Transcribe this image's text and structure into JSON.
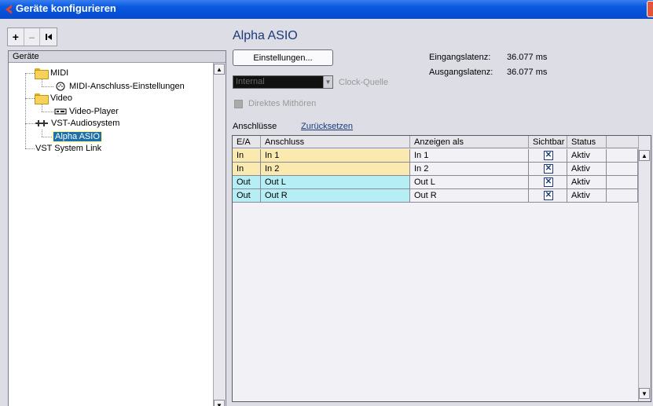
{
  "window": {
    "title": "Geräte konfigurieren"
  },
  "toolbar": {
    "add": "+",
    "remove": "–",
    "reset": "⏮"
  },
  "tree": {
    "header": "Geräte",
    "items": [
      {
        "label": "MIDI",
        "icon": "folder-icon"
      },
      {
        "label": "MIDI-Anschluss-Einstellungen",
        "icon": "midi-port-icon"
      },
      {
        "label": "Video",
        "icon": "folder-icon"
      },
      {
        "label": "Video-Player",
        "icon": "video-player-icon"
      },
      {
        "label": "VST-Audiosystem",
        "icon": "audio-system-icon"
      },
      {
        "label": "Alpha ASIO",
        "icon": "",
        "selected": true
      },
      {
        "label": "VST System Link",
        "icon": ""
      }
    ]
  },
  "main": {
    "title": "Alpha ASIO",
    "settings_button": "Einstellungen...",
    "input_latency_label": "Eingangslatenz:",
    "input_latency_value": "36.077 ms",
    "output_latency_label": "Ausgangslatenz:",
    "output_latency_value": "36.077 ms",
    "clock_source_value": "Internal",
    "clock_source_label": "Clock-Quelle",
    "direct_monitoring_label": "Direktes Mithören",
    "ports_label": "Anschlüsse",
    "reset_link": "Zurücksetzen"
  },
  "table": {
    "columns": [
      "E/A",
      "Anschluss",
      "Anzeigen als",
      "Sichtbar",
      "Status"
    ],
    "rows": [
      {
        "dir": "In",
        "port": "In 1",
        "show_as": "In 1",
        "visible": true,
        "status": "Aktiv"
      },
      {
        "dir": "In",
        "port": "In 2",
        "show_as": "In 2",
        "visible": true,
        "status": "Aktiv"
      },
      {
        "dir": "Out",
        "port": "Out L",
        "show_as": "Out L",
        "visible": true,
        "status": "Aktiv"
      },
      {
        "dir": "Out",
        "port": "Out R",
        "show_as": "Out R",
        "visible": true,
        "status": "Aktiv"
      }
    ]
  },
  "colors": {
    "input_row": "#fbeab0",
    "output_row": "#b6eef6",
    "heading": "#1a3a78",
    "titlebar": "#0650d8"
  }
}
